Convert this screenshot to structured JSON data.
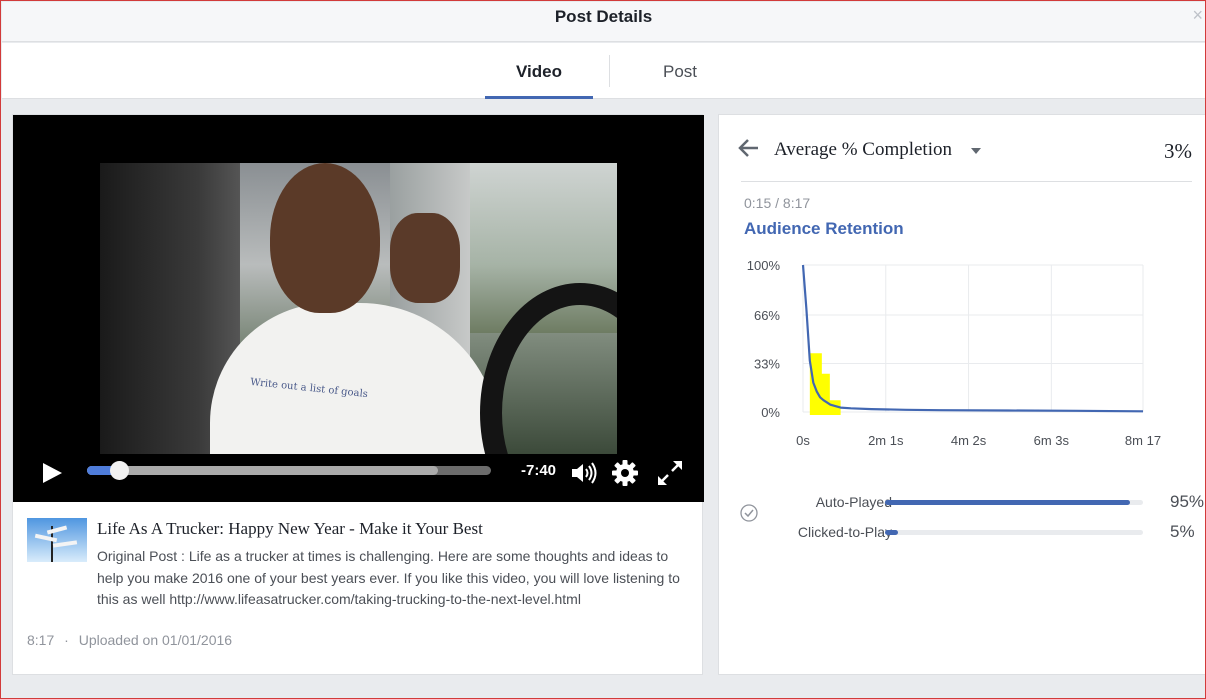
{
  "dialog": {
    "title": "Post Details",
    "close_glyph": "×"
  },
  "tabs": [
    {
      "label": "Video",
      "active": true
    },
    {
      "label": "Post",
      "active": false
    }
  ],
  "video": {
    "shirt_text": "Write out a list of goals",
    "remaining_time": "-7:40",
    "played_fraction": 0.08,
    "buffered_fraction": 0.87,
    "icons": [
      "play-icon",
      "volume-icon",
      "settings-gear-icon",
      "fullscreen-icon"
    ]
  },
  "post": {
    "title": "Life As A Trucker: Happy New Year - Make it Your Best",
    "description": "Original Post : Life as a trucker at times is challenging. Here are some thoughts and ideas to help you make 2016 one of your best years ever. If you like this video, you will love listening to this as well http://www.lifeasatrucker.com/taking-trucking-to-the-next-level.html",
    "duration": "8:17",
    "separator": "·",
    "uploaded": "Uploaded on 01/01/2016"
  },
  "metrics": {
    "selected_metric": "Average % Completion",
    "value": "3%",
    "timecode": "0:15 / 8:17",
    "retention_title": "Audience Retention"
  },
  "chart_data": {
    "type": "line",
    "title": "",
    "xlabel": "",
    "ylabel": "",
    "x_tick_labels": [
      "0s",
      "2m 1s",
      "4m 2s",
      "6m 3s",
      "8m 17"
    ],
    "x_tick_seconds": [
      0,
      121,
      242,
      363,
      497
    ],
    "y_tick_labels": [
      "100%",
      "66%",
      "33%",
      "0%"
    ],
    "y_tick_values": [
      100,
      66,
      33,
      0
    ],
    "xlim": [
      0,
      497
    ],
    "ylim": [
      0,
      100
    ],
    "grid": true,
    "line_color": "#4267b2",
    "highlight_color": "#ffff00",
    "highlight_x_range": [
      10,
      55
    ],
    "series": [
      {
        "x": [
          0,
          5,
          10,
          15,
          20,
          25,
          30,
          40,
          55,
          70,
          100,
          150,
          200,
          300,
          400,
          497
        ],
        "y": [
          100,
          70,
          35,
          20,
          14,
          10,
          8,
          5,
          3,
          2.5,
          2,
          1.5,
          1.2,
          1,
          0.8,
          0.5
        ]
      }
    ]
  },
  "play_stats": [
    {
      "label": "Auto-Played",
      "percent_text": "95%",
      "value": 95
    },
    {
      "label": "Clicked-to-Play",
      "percent_text": "5%",
      "value": 5
    }
  ],
  "colors": {
    "accent": "#4267b2",
    "progress_played": "#4f7ddb"
  }
}
